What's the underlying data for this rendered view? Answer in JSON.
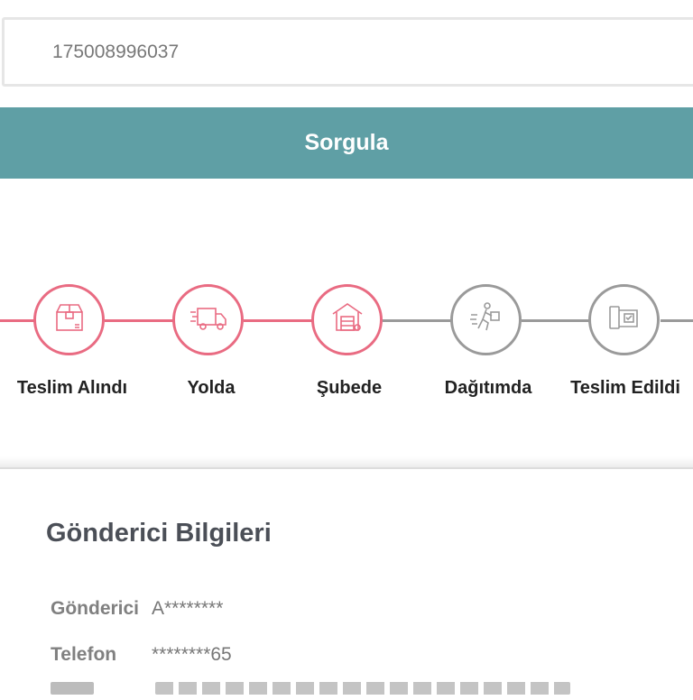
{
  "search": {
    "value": "175008996037"
  },
  "query_button": {
    "label": "Sorgula"
  },
  "colors": {
    "accent": "#5f9fa5",
    "done": "#e96b82",
    "pending": "#9a9a9a"
  },
  "tracker": {
    "steps": [
      {
        "label": "Teslim Alındı",
        "icon": "package-icon",
        "status": "done"
      },
      {
        "label": "Yolda",
        "icon": "truck-icon",
        "status": "done"
      },
      {
        "label": "Şubede",
        "icon": "branch-icon",
        "status": "done"
      },
      {
        "label": "Dağıtımda",
        "icon": "courier-icon",
        "status": "pending"
      },
      {
        "label": "Teslim Edildi",
        "icon": "delivered-icon",
        "status": "pending"
      }
    ]
  },
  "sender": {
    "title": "Gönderici Bilgileri",
    "rows": [
      {
        "label": "Gönderici",
        "value": "A********"
      },
      {
        "label": "Telefon",
        "value": "********65"
      }
    ]
  }
}
